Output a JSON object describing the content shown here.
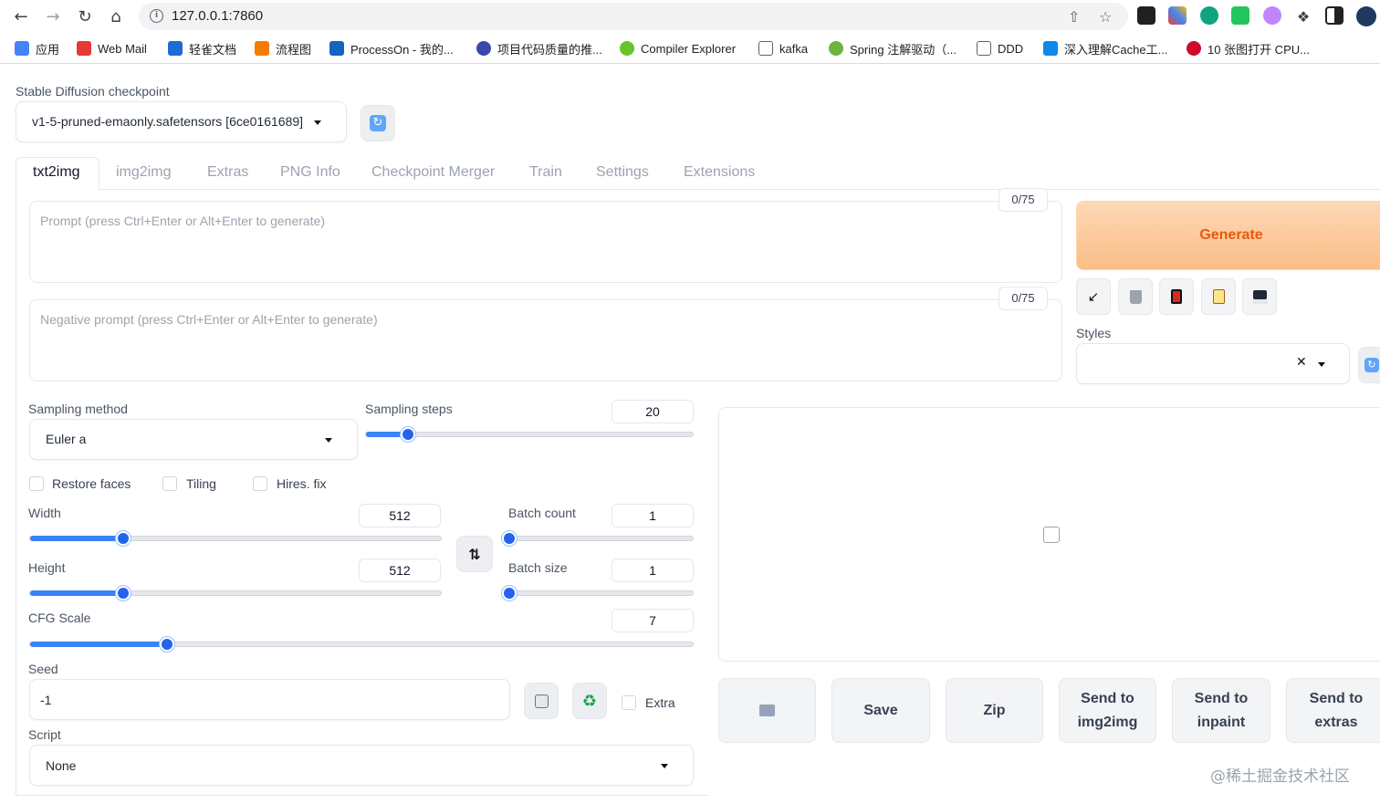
{
  "browser": {
    "url": "127.0.0.1:7860",
    "bookmarks": [
      {
        "label": "应用",
        "icon": "apps-grid-icon",
        "color": "#4285f4"
      },
      {
        "label": "Web Mail",
        "icon": "webmail-icon",
        "color": "#e53935"
      },
      {
        "label": "轻雀文档",
        "icon": "yuque-icon",
        "color": "#1e6bd6"
      },
      {
        "label": "流程图",
        "icon": "flowchart-icon",
        "color": "#f57c00"
      },
      {
        "label": "ProcessOn - 我的...",
        "icon": "processon-icon",
        "color": "#1565c0"
      },
      {
        "label": "项目代码质量的推...",
        "icon": "moon-icon",
        "color": "#3949ab"
      },
      {
        "label": "Compiler Explorer",
        "icon": "compiler-explorer-icon",
        "color": "#67c52a"
      },
      {
        "label": "kafka",
        "icon": "folder-icon",
        "color": "#5f6368"
      },
      {
        "label": "Spring 注解驱动（...",
        "icon": "spring-icon",
        "color": "#6db33f"
      },
      {
        "label": "DDD",
        "icon": "folder-icon",
        "color": "#5f6368"
      },
      {
        "label": "深入理解Cache工...",
        "icon": "zhihu-icon",
        "color": "#0f88eb"
      },
      {
        "label": "10 张图打开 CPU...",
        "icon": "huawei-icon",
        "color": "#cf0a2c"
      }
    ]
  },
  "checkpoint": {
    "label": "Stable Diffusion checkpoint",
    "value": "v1-5-pruned-emaonly.safetensors [6ce0161689]"
  },
  "tabs": [
    "txt2img",
    "img2img",
    "Extras",
    "PNG Info",
    "Checkpoint Merger",
    "Train",
    "Settings",
    "Extensions"
  ],
  "prompt": {
    "placeholder": "Prompt (press Ctrl+Enter or Alt+Enter to generate)",
    "counter": "0/75"
  },
  "negative_prompt": {
    "placeholder": "Negative prompt (press Ctrl+Enter or Alt+Enter to generate)",
    "counter": "0/75"
  },
  "generate_label": "Generate",
  "styles_label": "Styles",
  "sampling": {
    "method_label": "Sampling method",
    "method_value": "Euler a",
    "steps_label": "Sampling steps",
    "steps_value": "20",
    "steps": 20
  },
  "checkboxes": {
    "restore_faces": "Restore faces",
    "tiling": "Tiling",
    "hires_fix": "Hires. fix",
    "extra": "Extra"
  },
  "width": {
    "label": "Width",
    "value": "512",
    "v": 512
  },
  "height": {
    "label": "Height",
    "value": "512",
    "v": 512
  },
  "batch_count": {
    "label": "Batch count",
    "value": "1",
    "v": 1
  },
  "batch_size": {
    "label": "Batch size",
    "value": "1",
    "v": 1
  },
  "cfg_scale": {
    "label": "CFG Scale",
    "value": "7",
    "v": 7
  },
  "seed": {
    "label": "Seed",
    "value": "-1"
  },
  "script": {
    "label": "Script",
    "value": "None"
  },
  "output_buttons": {
    "save": "Save",
    "zip": "Zip",
    "send_img2img": "Send to img2img",
    "send_inpaint": "Send to inpaint",
    "send_extras": "Send to extras"
  },
  "watermark": "@稀土掘金技术社区",
  "colors": {
    "accent": "#3b82f6",
    "generate_text": "#ea580c",
    "generate_bg": "#fbbd86"
  }
}
